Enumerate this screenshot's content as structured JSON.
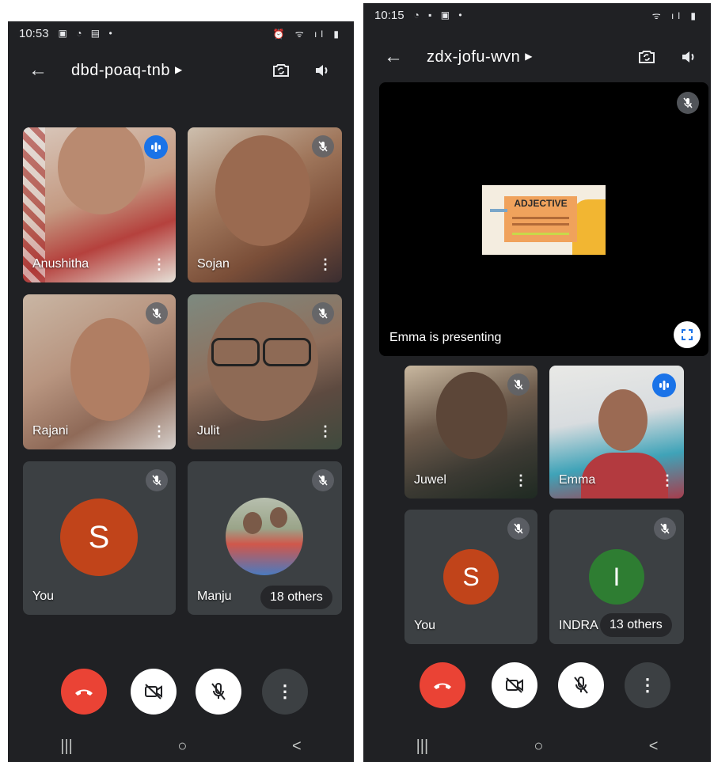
{
  "left": {
    "status": {
      "time": "10:53",
      "icons": "▣ ◔ ▤ •",
      "right_icons": "⏰ ᯤ ıl ▮"
    },
    "meeting_code": "dbd-poaq-tnb",
    "tiles": [
      {
        "name": "Anushitha"
      },
      {
        "name": "Sojan"
      },
      {
        "name": "Rajani"
      },
      {
        "name": "Julit"
      },
      {
        "name": "You",
        "avatar_letter": "S"
      },
      {
        "name": "Manju",
        "others": "18 others"
      }
    ],
    "colors": {
      "avatar_you": "#c1441a",
      "end_call": "#ea4335"
    }
  },
  "right": {
    "status": {
      "time": "10:15",
      "icons": "◔ ▪ ▣ •",
      "right_icons": "ᯤ ıl ▮"
    },
    "meeting_code": "zdx-jofu-wvn",
    "presentation": {
      "caption": "Emma is presenting",
      "slide_title": "ADJECTIVE"
    },
    "tiles": [
      {
        "name": "Juwel"
      },
      {
        "name": "Emma"
      },
      {
        "name": "You",
        "avatar_letter": "S"
      },
      {
        "name": "INDRA",
        "avatar_letter": "I",
        "others": "13 others"
      }
    ],
    "colors": {
      "avatar_you": "#c1441a",
      "avatar_indra": "#2e7d32",
      "end_call": "#ea4335"
    }
  },
  "navbar": {
    "recents": "|||",
    "home": "○",
    "back": "<"
  }
}
